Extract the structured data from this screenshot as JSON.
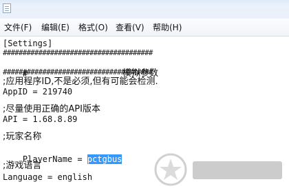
{
  "menu": {
    "items": [
      {
        "label": "文件(F)"
      },
      {
        "label": "编辑(E)"
      },
      {
        "label": "格式(O)"
      },
      {
        "label": "查看(V)"
      },
      {
        "label": "帮助(H)"
      }
    ]
  },
  "editor": {
    "lines": {
      "section": "[Settings]",
      "hash_line_top": "######################################",
      "title_line_prefix": "#",
      "title": "模拟参数",
      "hash_line_bottom": "######################################",
      "comment_appid": ";应用程序ID,不是必须,但有可能会检测.",
      "appid": "AppID = 219740",
      "comment_api": ";尽量使用正确的API版本",
      "api": "API = 1.68.8.89",
      "comment_player": ";玩家名称",
      "player_key": "PlayerName = ",
      "player_value": "pctgbus",
      "comment_lang": ";游戏语言",
      "language": "Language = english"
    }
  },
  "colors": {
    "selection": "#3399ff",
    "menubar": "#f0f3f8"
  }
}
